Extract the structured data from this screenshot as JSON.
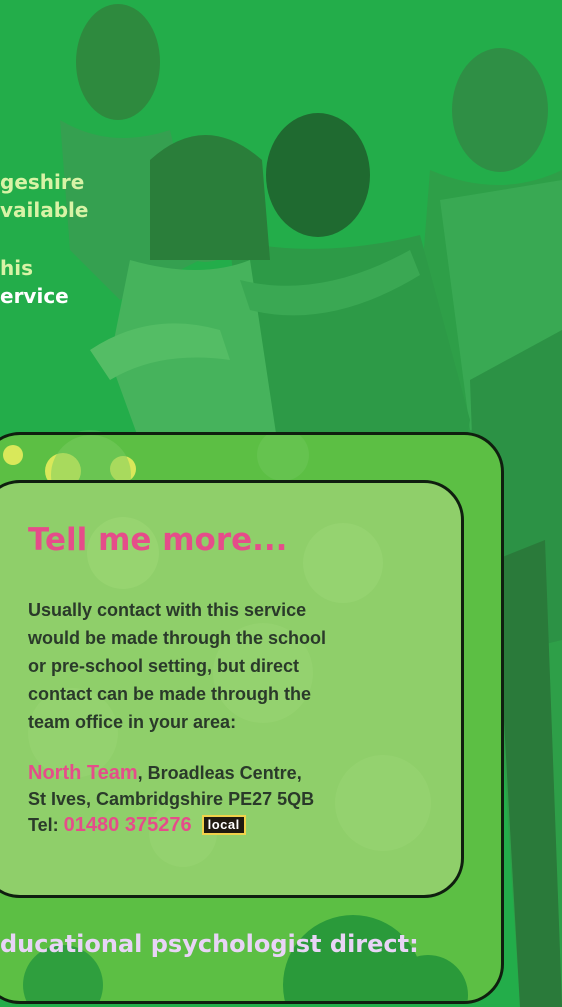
{
  "hero": {
    "line1": "geshire",
    "line2": "vailable",
    "line3": "his",
    "line4": "ervice"
  },
  "card": {
    "title": "Tell me more...",
    "body_lines": [
      "Usually contact with this service",
      "would be made through the school",
      "or pre-school setting, but direct",
      "contact can be made through the",
      "team office in your area:"
    ],
    "contact": {
      "team_name": "North Team",
      "address1": ", Broadleas Centre,",
      "address2": "St Ives, Cambridgshire PE27 5QB",
      "tel_label": "Tel: ",
      "tel_number": "01480 375276",
      "badge": "local"
    }
  },
  "footer_text": "ducational psychologist direct:",
  "colors": {
    "background": "#23ad4a",
    "accent_pink": "#e54d8a",
    "card_green": "#8fcf6a",
    "outer_green": "#5cbf44"
  }
}
